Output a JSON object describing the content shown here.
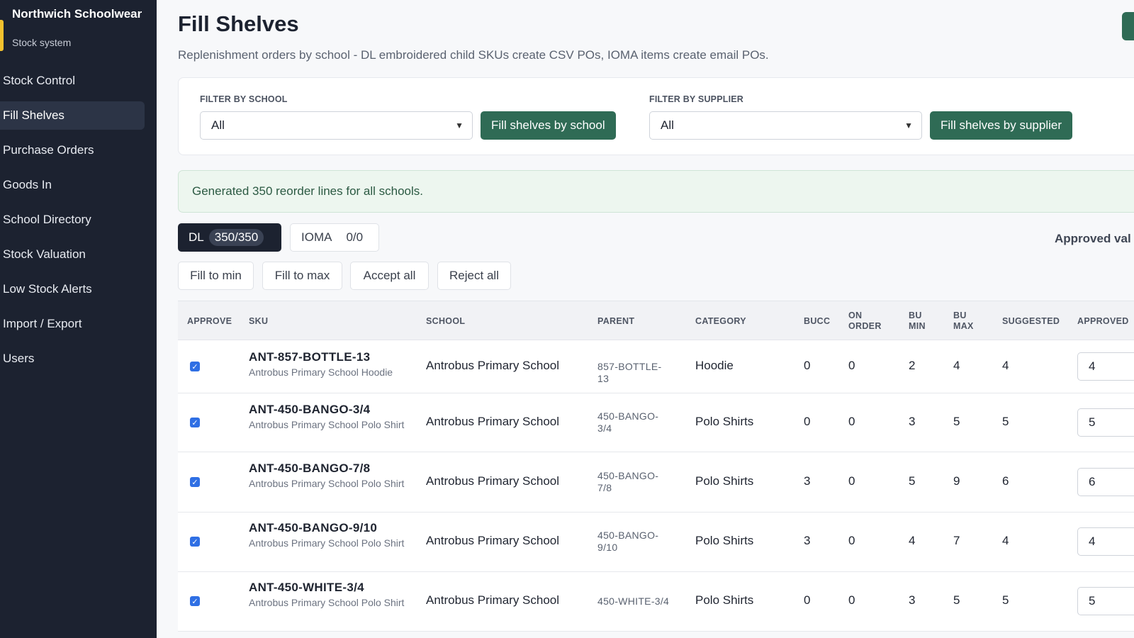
{
  "brand": {
    "name": "Northwich Schoolwear",
    "subtitle": "Stock system"
  },
  "nav": [
    {
      "label": "Stock Control",
      "active": false
    },
    {
      "label": "Fill Shelves",
      "active": true
    },
    {
      "label": "Purchase Orders",
      "active": false
    },
    {
      "label": "Goods In",
      "active": false
    },
    {
      "label": "School Directory",
      "active": false
    },
    {
      "label": "Stock Valuation",
      "active": false
    },
    {
      "label": "Low Stock Alerts",
      "active": false
    },
    {
      "label": "Import / Export",
      "active": false
    },
    {
      "label": "Users",
      "active": false
    }
  ],
  "page": {
    "title": "Fill Shelves",
    "subtitle": "Replenishment orders by school - DL embroidered child SKUs create CSV POs, IOMA items create email POs."
  },
  "filters": {
    "school_label": "FILTER BY SCHOOL",
    "school_value": "All",
    "school_button": "Fill shelves by school",
    "supplier_label": "FILTER BY SUPPLIER",
    "supplier_value": "All",
    "supplier_button": "Fill shelves by supplier"
  },
  "alert": "Generated 350 reorder lines for all schools.",
  "tabs": {
    "dl_label": "DL",
    "dl_count": "350/350",
    "ioma_label": "IOMA",
    "ioma_count": "0/0"
  },
  "approved_value_label": "Approved val",
  "actions": {
    "fill_min": "Fill to min",
    "fill_max": "Fill to max",
    "accept_all": "Accept all",
    "reject_all": "Reject all"
  },
  "table": {
    "headers": {
      "approve": "APPROVE",
      "sku": "SKU",
      "school": "SCHOOL",
      "parent": "PARENT",
      "category": "CATEGORY",
      "bucc": "BUCC",
      "on_order": "ON ORDER",
      "bu_min": "BU MIN",
      "bu_max": "BU MAX",
      "suggested": "SUGGESTED",
      "approved": "APPROVED"
    },
    "rows": [
      {
        "approved_check": true,
        "sku": "ANT-857-BOTTLE-13",
        "desc": "Antrobus Primary School Hoodie",
        "school": "Antrobus Primary School",
        "parent": "857-BOTTLE-13",
        "category": "Hoodie",
        "bucc": "0",
        "on_order": "0",
        "bu_min": "2",
        "bu_max": "4",
        "suggested": "4",
        "approved": "4"
      },
      {
        "approved_check": true,
        "sku": "ANT-450-BANGO-3/4",
        "desc": "Antrobus Primary School Polo Shirt",
        "school": "Antrobus Primary School",
        "parent": "450-BANGO-3/4",
        "category": "Polo Shirts",
        "bucc": "0",
        "on_order": "0",
        "bu_min": "3",
        "bu_max": "5",
        "suggested": "5",
        "approved": "5"
      },
      {
        "approved_check": true,
        "sku": "ANT-450-BANGO-7/8",
        "desc": "Antrobus Primary School Polo Shirt",
        "school": "Antrobus Primary School",
        "parent": "450-BANGO-7/8",
        "category": "Polo Shirts",
        "bucc": "3",
        "on_order": "0",
        "bu_min": "5",
        "bu_max": "9",
        "suggested": "6",
        "approved": "6"
      },
      {
        "approved_check": true,
        "sku": "ANT-450-BANGO-9/10",
        "desc": "Antrobus Primary School Polo Shirt",
        "school": "Antrobus Primary School",
        "parent": "450-BANGO-9/10",
        "category": "Polo Shirts",
        "bucc": "3",
        "on_order": "0",
        "bu_min": "4",
        "bu_max": "7",
        "suggested": "4",
        "approved": "4"
      },
      {
        "approved_check": true,
        "sku": "ANT-450-WHITE-3/4",
        "desc": "Antrobus Primary School Polo Shirt",
        "school": "Antrobus Primary School",
        "parent": "450-WHITE-3/4",
        "category": "Polo Shirts",
        "bucc": "0",
        "on_order": "0",
        "bu_min": "3",
        "bu_max": "5",
        "suggested": "5",
        "approved": "5"
      }
    ]
  }
}
